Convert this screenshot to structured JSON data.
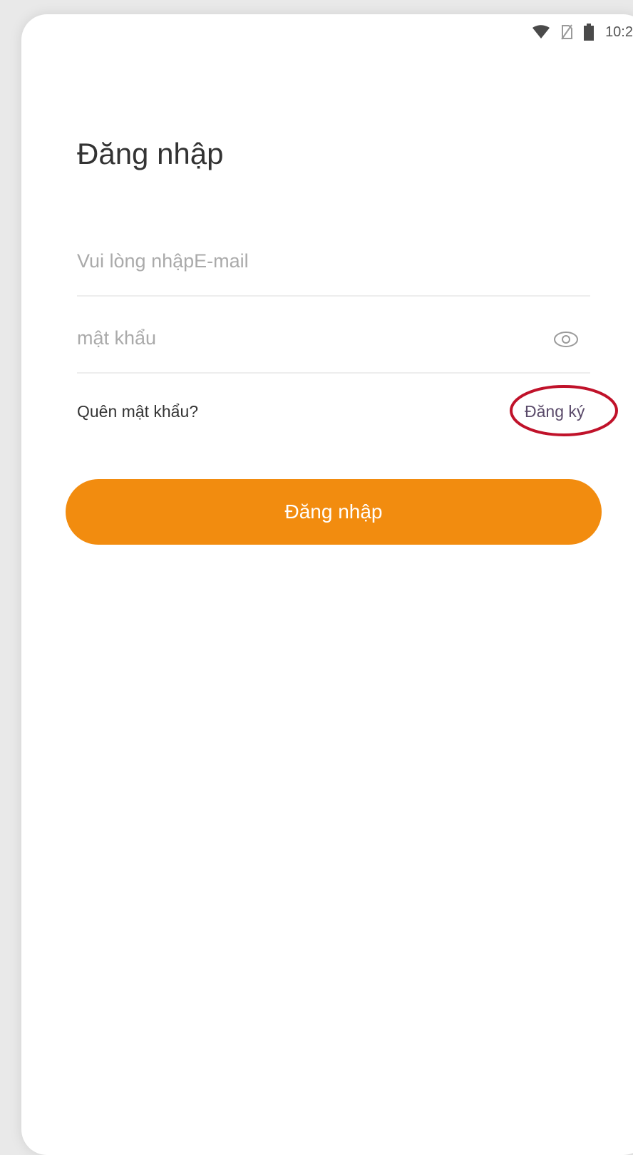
{
  "status_bar": {
    "time": "10:2",
    "icons": [
      "wifi-icon",
      "no-sim-icon",
      "battery-icon"
    ]
  },
  "login": {
    "title": "Đăng nhập",
    "email": {
      "placeholder": "Vui lòng nhậpE-mail",
      "value": ""
    },
    "password": {
      "placeholder": "mật khẩu",
      "value": "",
      "toggle_icon": "eye-icon"
    },
    "forgot_password_label": "Quên mật khẩu?",
    "register_label": "Đăng ký",
    "submit_label": "Đăng nhập"
  },
  "colors": {
    "accent": "#f28c0f",
    "highlight_ring": "#c0122a",
    "text": "#333333",
    "placeholder": "#aaaaaa",
    "divider": "#ededed"
  }
}
